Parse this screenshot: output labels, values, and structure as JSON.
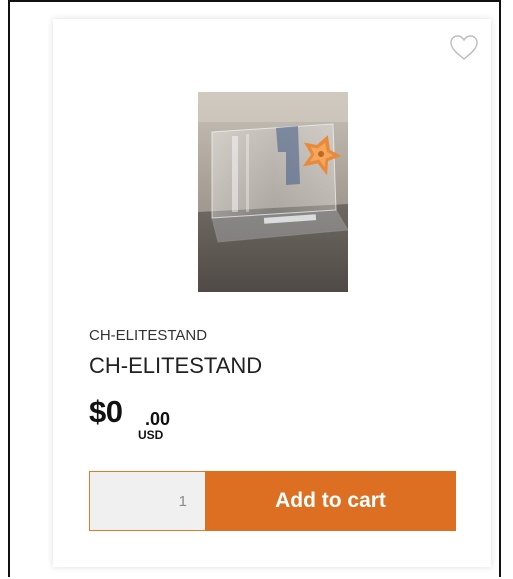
{
  "product": {
    "sku": "CH-ELITESTAND",
    "name": "CH-ELITESTAND",
    "price": {
      "main": "$0",
      "cents": ".00",
      "currency": "USD"
    },
    "quantity": "1",
    "add_to_cart_label": "Add to cart",
    "image_icon": "acrylic-stand-photo",
    "wishlist_icon": "heart-outline-icon"
  },
  "colors": {
    "accent": "#dc6f22",
    "accent_border": "#e07a2a",
    "qty_background": "#f0f0f0"
  }
}
